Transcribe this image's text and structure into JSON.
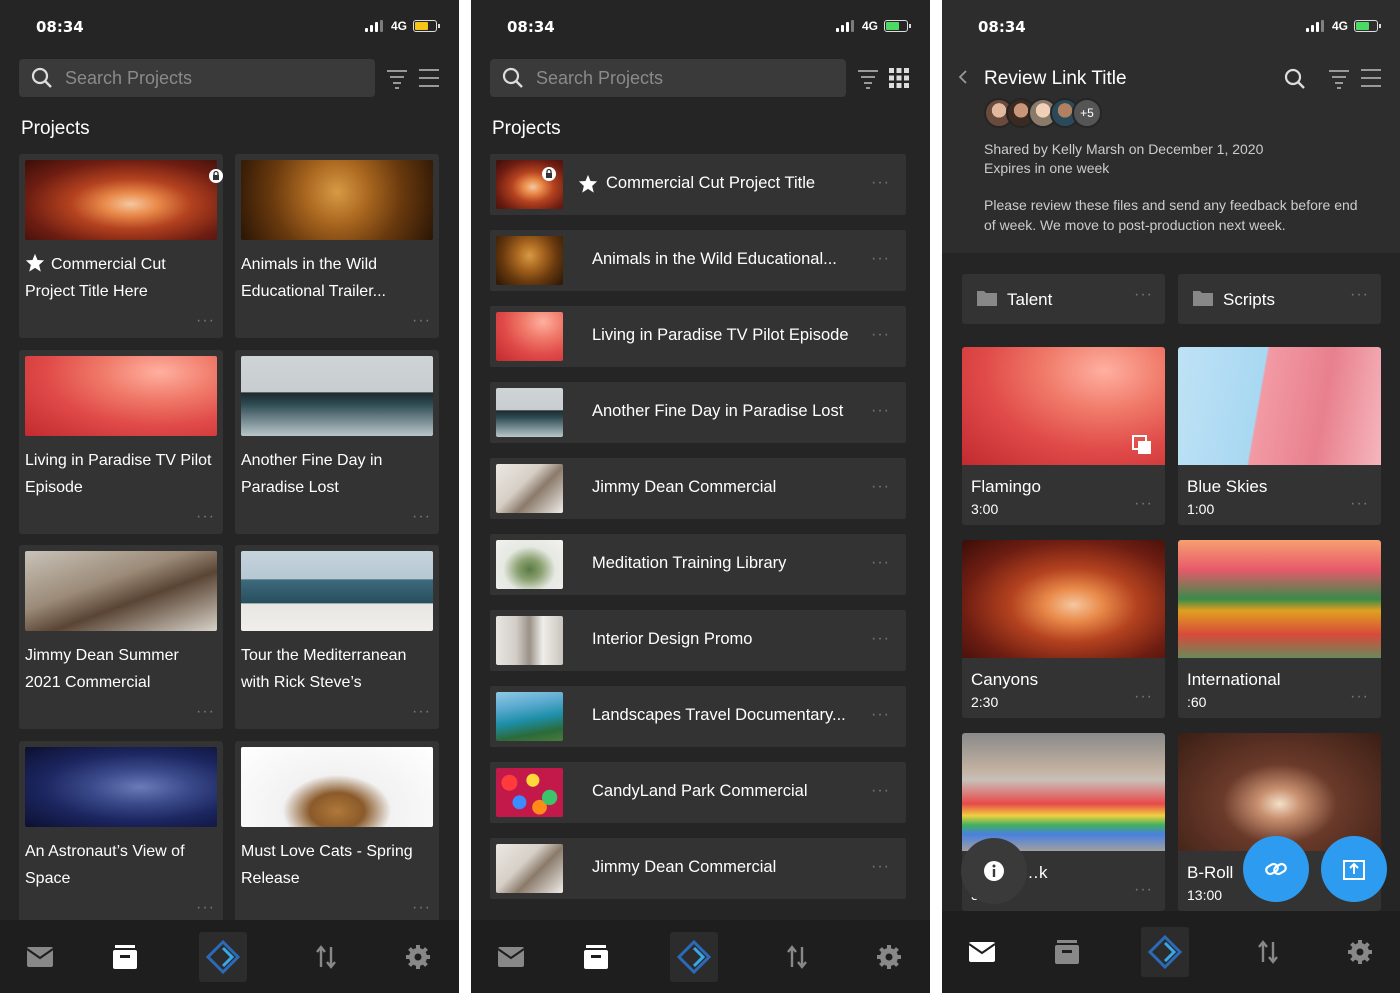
{
  "status": {
    "time": "08:34",
    "network": "4G"
  },
  "colors": {
    "accent": "#2d9cf0",
    "background": "#252525",
    "card": "#333333",
    "nav": "#1e1e1e",
    "battery_low": "#f5c518",
    "battery_ok": "#4cd964"
  },
  "search": {
    "placeholder": "Search Projects"
  },
  "projects_heading": "Projects",
  "more_label": "···",
  "grid_projects": [
    {
      "title": "Commercial Cut Project Title Here",
      "starred": true,
      "locked": true,
      "thumb": "canyon"
    },
    {
      "title": "Animals in the Wild Educational Trailer...",
      "thumb": "lion"
    },
    {
      "title": "Living in Paradise TV Pilot Episode",
      "thumb": "flamingo"
    },
    {
      "title": "Another Fine Day in Paradise Lost",
      "thumb": "island"
    },
    {
      "title": "Jimmy Dean Summer 2021 Commercial",
      "thumb": "beach"
    },
    {
      "title": "Tour the Mediterranean with Rick Steve’s",
      "thumb": "sea"
    },
    {
      "title": "An Astronaut’s View of Space",
      "thumb": "space"
    },
    {
      "title": "Must Love Cats - Spring Release",
      "thumb": "cats"
    }
  ],
  "list_projects": [
    {
      "title": "Commercial Cut Project Title",
      "starred": true,
      "locked": true,
      "thumb": "canyon"
    },
    {
      "title": "Animals in the Wild Educational...",
      "thumb": "lion"
    },
    {
      "title": "Living in Paradise TV Pilot Episode",
      "thumb": "flamingo"
    },
    {
      "title": "Another Fine Day in Paradise Lost",
      "thumb": "island"
    },
    {
      "title": "Jimmy Dean Commercial",
      "thumb": "kitchen"
    },
    {
      "title": "Meditation Training Library",
      "thumb": "plant"
    },
    {
      "title": "Interior Design Promo",
      "thumb": "interior"
    },
    {
      "title": "Landscapes Travel Documentary...",
      "thumb": "coast"
    },
    {
      "title": "CandyLand Park Commercial",
      "thumb": "candy"
    },
    {
      "title": "Jimmy Dean Commercial",
      "thumb": "kitchen"
    }
  ],
  "review": {
    "back_icon": "chevron-left-icon",
    "title": "Review Link Title",
    "extra_viewers": "+5",
    "shared_by": "Shared by Kelly Marsh on December 1, 2020",
    "expires": "Expires in one week",
    "message": "Please review these files and send any feedback before end of week. We move to post-production next week.",
    "folders": [
      {
        "name": "Talent"
      },
      {
        "name": "Scripts"
      }
    ],
    "assets": [
      {
        "name": "Flamingo",
        "duration": "3:00",
        "thumb": "flamingo",
        "stack": true
      },
      {
        "name": "Blue Skies",
        "duration": "1:00",
        "thumb": "pink-building"
      },
      {
        "name": "Canyons",
        "duration": "2:30",
        "thumb": "canyon"
      },
      {
        "name": "International",
        "duration": ":60",
        "thumb": "temple"
      },
      {
        "name": "…k",
        "duration": "3…",
        "thumb": "crosswalk"
      },
      {
        "name": "B-Roll",
        "duration": "13:00",
        "thumb": "corridor"
      }
    ],
    "fabs": [
      "info-icon",
      "link-icon",
      "upload-icon"
    ]
  },
  "nav": [
    "inbox-icon",
    "archive-icon",
    "app-logo",
    "transfer-icon",
    "settings-icon"
  ]
}
